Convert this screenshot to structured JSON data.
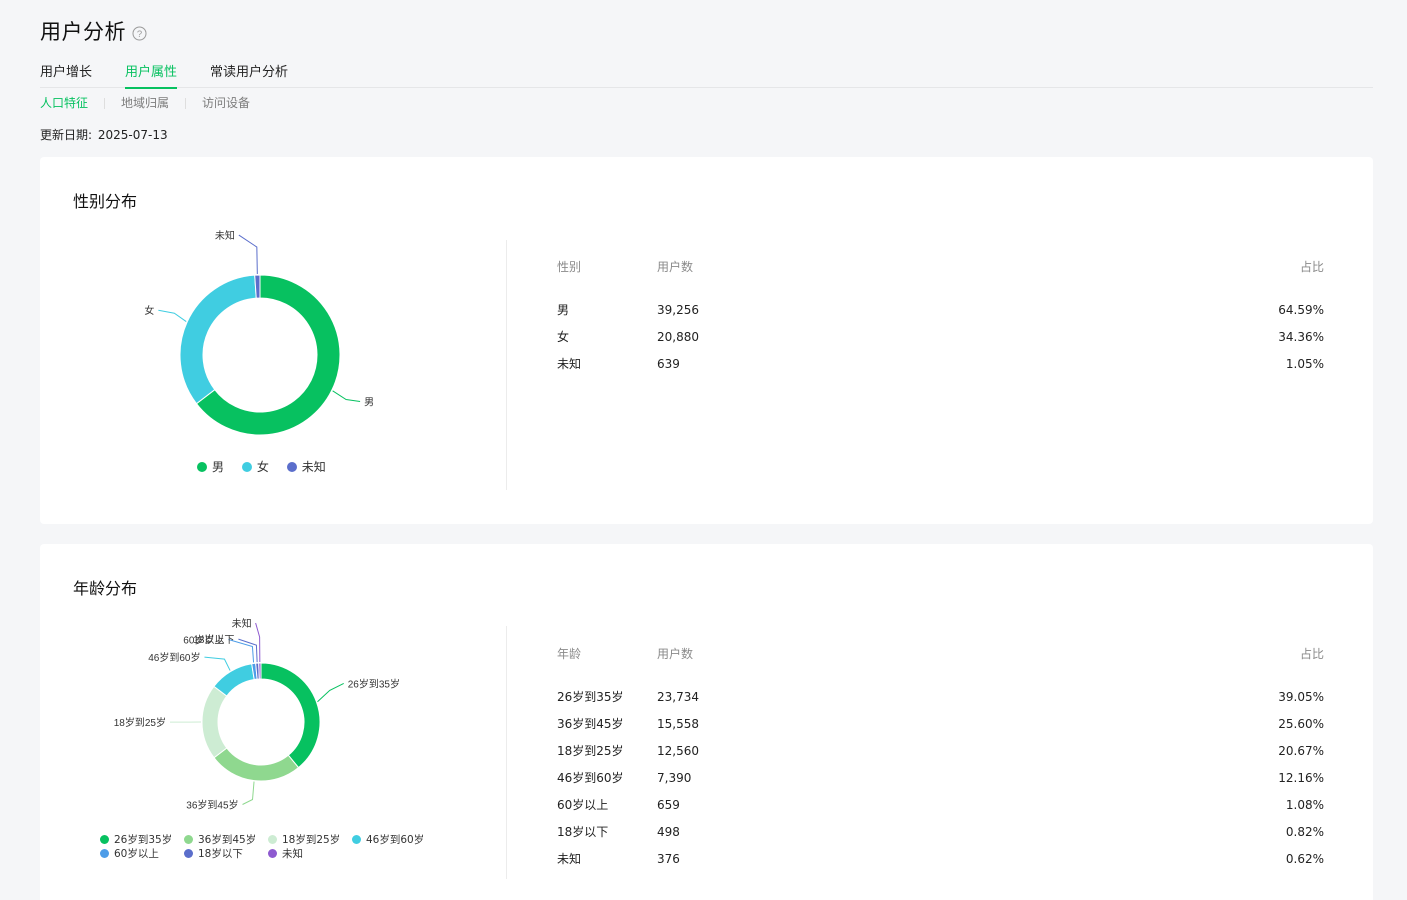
{
  "page": {
    "title": "用户分析",
    "help_icon": "question-circle-icon"
  },
  "tabs": [
    {
      "label": "用户增长",
      "active": false
    },
    {
      "label": "用户属性",
      "active": true
    },
    {
      "label": "常读用户分析",
      "active": false
    }
  ],
  "subtabs": [
    {
      "label": "人口特征",
      "active": true
    },
    {
      "label": "地域归属",
      "active": false
    },
    {
      "label": "访问设备",
      "active": false
    }
  ],
  "update": {
    "label": "更新日期:",
    "date": "2025-07-13"
  },
  "colors": {
    "accent": "#07c160",
    "male": "#07c160",
    "female": "#40cde1",
    "unknown": "#5b6ecb",
    "age_26_35": "#07c160",
    "age_36_45": "#8fd88f",
    "age_18_25": "#cdecd3",
    "age_46_60": "#40cde1",
    "age_60_plus": "#4e9de8",
    "age_under_18": "#5b6ecb",
    "age_unknown": "#8e5ad0"
  },
  "gender": {
    "title": "性别分布",
    "headers": [
      "性别",
      "用户数",
      "占比"
    ],
    "rows": [
      {
        "label": "男",
        "count": "39,256",
        "pct": "64.59%"
      },
      {
        "label": "女",
        "count": "20,880",
        "pct": "34.36%"
      },
      {
        "label": "未知",
        "count": "639",
        "pct": "1.05%"
      }
    ],
    "legend": [
      "男",
      "女",
      "未知"
    ]
  },
  "age": {
    "title": "年龄分布",
    "headers": [
      "年龄",
      "用户数",
      "占比"
    ],
    "rows": [
      {
        "label": "26岁到35岁",
        "count": "23,734",
        "pct": "39.05%"
      },
      {
        "label": "36岁到45岁",
        "count": "15,558",
        "pct": "25.60%"
      },
      {
        "label": "18岁到25岁",
        "count": "12,560",
        "pct": "20.67%"
      },
      {
        "label": "46岁到60岁",
        "count": "7,390",
        "pct": "12.16%"
      },
      {
        "label": "60岁以上",
        "count": "659",
        "pct": "1.08%"
      },
      {
        "label": "18岁以下",
        "count": "498",
        "pct": "0.82%"
      },
      {
        "label": "未知",
        "count": "376",
        "pct": "0.62%"
      }
    ],
    "legend": [
      "26岁到35岁",
      "36岁到45岁",
      "18岁到25岁",
      "46岁到60岁",
      "60岁以上",
      "18岁以下",
      "未知"
    ]
  },
  "chart_data": [
    {
      "type": "pie",
      "categories": [
        "男",
        "女",
        "未知"
      ],
      "values": [
        39256,
        20880,
        639
      ],
      "percent": [
        64.59,
        34.36,
        1.05
      ]
    },
    {
      "type": "pie",
      "categories": [
        "26岁到35岁",
        "36岁到45岁",
        "18岁到25岁",
        "46岁到60岁",
        "60岁以上",
        "18岁以下",
        "未知"
      ],
      "values": [
        23734,
        15558,
        12560,
        7390,
        659,
        498,
        376
      ],
      "percent": [
        39.05,
        25.6,
        20.67,
        12.16,
        1.08,
        0.82,
        0.62
      ]
    }
  ]
}
